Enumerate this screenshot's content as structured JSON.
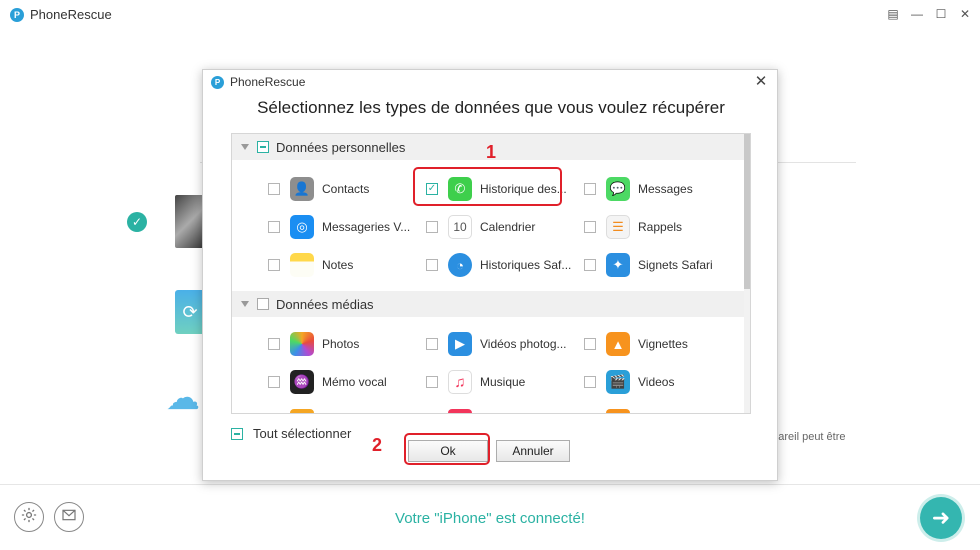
{
  "app": {
    "logo_letter": "P",
    "title": "PhoneRescue"
  },
  "window_controls": [
    "▤",
    "—",
    "☐",
    "✕"
  ],
  "background": {
    "side_text": "ppareil peut être",
    "status_text": "Votre \"iPhone\" est connecté!",
    "next_icon": "arrow-right-icon"
  },
  "dialog": {
    "logo_letter": "P",
    "app_title": "PhoneRescue",
    "close_label": "✕",
    "heading": "Sélectionnez les types de données que vous voulez récupérer",
    "sections": [
      {
        "label": "Données personnelles",
        "state": "partial",
        "items": [
          {
            "label": "Contacts",
            "checked": false,
            "icon": "contacts-icon",
            "color": "#8e8e8e"
          },
          {
            "label": "Historique des...",
            "checked": true,
            "icon": "phone-icon",
            "color": "#3ecf4c"
          },
          {
            "label": "Messages",
            "checked": false,
            "icon": "messages-icon",
            "color": "#4cd964"
          },
          {
            "label": "Messageries V...",
            "checked": false,
            "icon": "voicemail-icon",
            "color": "#1a8ef2"
          },
          {
            "label": "Calendrier",
            "checked": false,
            "icon": "calendar-icon",
            "color": "#ffffff"
          },
          {
            "label": "Rappels",
            "checked": false,
            "icon": "reminders-icon",
            "color": "#f4f4f4"
          },
          {
            "label": "Notes",
            "checked": false,
            "icon": "notes-icon",
            "color": "#ffd84a"
          },
          {
            "label": "Historiques Saf...",
            "checked": false,
            "icon": "safari-history-icon",
            "color": "#2b8fe0"
          },
          {
            "label": "Signets Safari",
            "checked": false,
            "icon": "safari-bookmarks-icon",
            "color": "#2b8fe0"
          }
        ]
      },
      {
        "label": "Données médias",
        "state": "empty",
        "items": [
          {
            "label": "Photos",
            "checked": false,
            "icon": "photos-icon",
            "color": "#f5a623"
          },
          {
            "label": "Vidéos photog...",
            "checked": false,
            "icon": "photo-videos-icon",
            "color": "#2b8fe0"
          },
          {
            "label": "Vignettes",
            "checked": false,
            "icon": "thumbnails-icon",
            "color": "#f7931e"
          },
          {
            "label": "Mémo vocal",
            "checked": false,
            "icon": "voice-memo-icon",
            "color": "#222222"
          },
          {
            "label": "Musique",
            "checked": false,
            "icon": "music-icon",
            "color": "#ffffff"
          },
          {
            "label": "Videos",
            "checked": false,
            "icon": "videos-icon",
            "color": "#2a9fd8"
          }
        ]
      }
    ],
    "select_all_label": "Tout sélectionner",
    "ok_label": "Ok",
    "cancel_label": "Annuler"
  },
  "annotations": {
    "first": "1",
    "second": "2",
    "color": "#e0202a"
  }
}
